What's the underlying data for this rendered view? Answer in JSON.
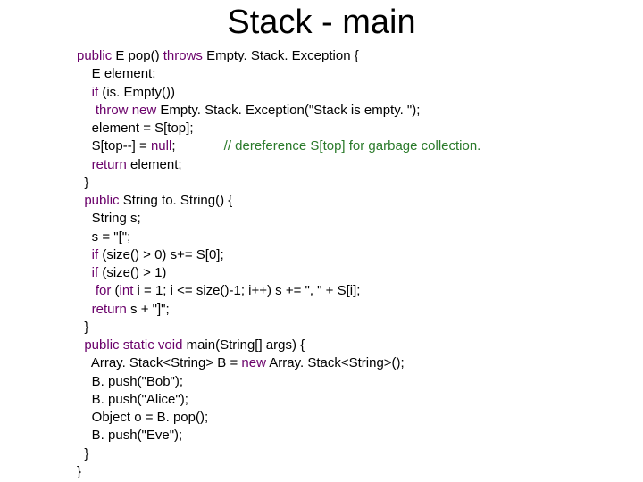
{
  "title": "Stack - main",
  "code": {
    "l01a": "public",
    "l01b": " E pop() ",
    "l01c": "throws",
    "l01d": " Empty. Stack. Exception {",
    "l02": "    E element;",
    "l03a": "    if",
    "l03b": " (is. Empty())",
    "l04a": "     throw",
    "l04b": " ",
    "l04c": "new",
    "l04d": " Empty. Stack. Exception(\"Stack is empty. \");",
    "l05": "    element = S[top];",
    "l06a": "    S[top--] = ",
    "l06b": "null",
    "l06c": ";             ",
    "l06d": "// dereference S[top] for garbage collection.",
    "l07a": "    return",
    "l07b": " element;",
    "l08": "  }",
    "l09a": "  public",
    "l09b": " String to. String() {",
    "l10": "    String s;",
    "l11": "    s = \"[\";",
    "l12a": "    if",
    "l12b": " (size() > 0) s+= S[0];",
    "l13a": "    if",
    "l13b": " (size() > 1)",
    "l14a": "     for",
    "l14b": " (",
    "l14c": "int",
    "l14d": " i = 1; i <= size()-1; i++) s += \", \" + S[i];",
    "l15a": "    return",
    "l15b": " s + \"]\";",
    "l16": "  }",
    "l17a": "  public",
    "l17b": " ",
    "l17c": "static",
    "l17d": " ",
    "l17e": "void",
    "l17f": " main(String[] args) {",
    "l18a": "    Array. Stack<String> B = ",
    "l18b": "new",
    "l18c": " Array. Stack<String>();",
    "l19": "    B. push(\"Bob\");",
    "l20": "    B. push(\"Alice\");",
    "l21": "    Object o = B. pop();",
    "l22": "    B. push(\"Eve\");",
    "l23": "  }",
    "l24": "}"
  }
}
